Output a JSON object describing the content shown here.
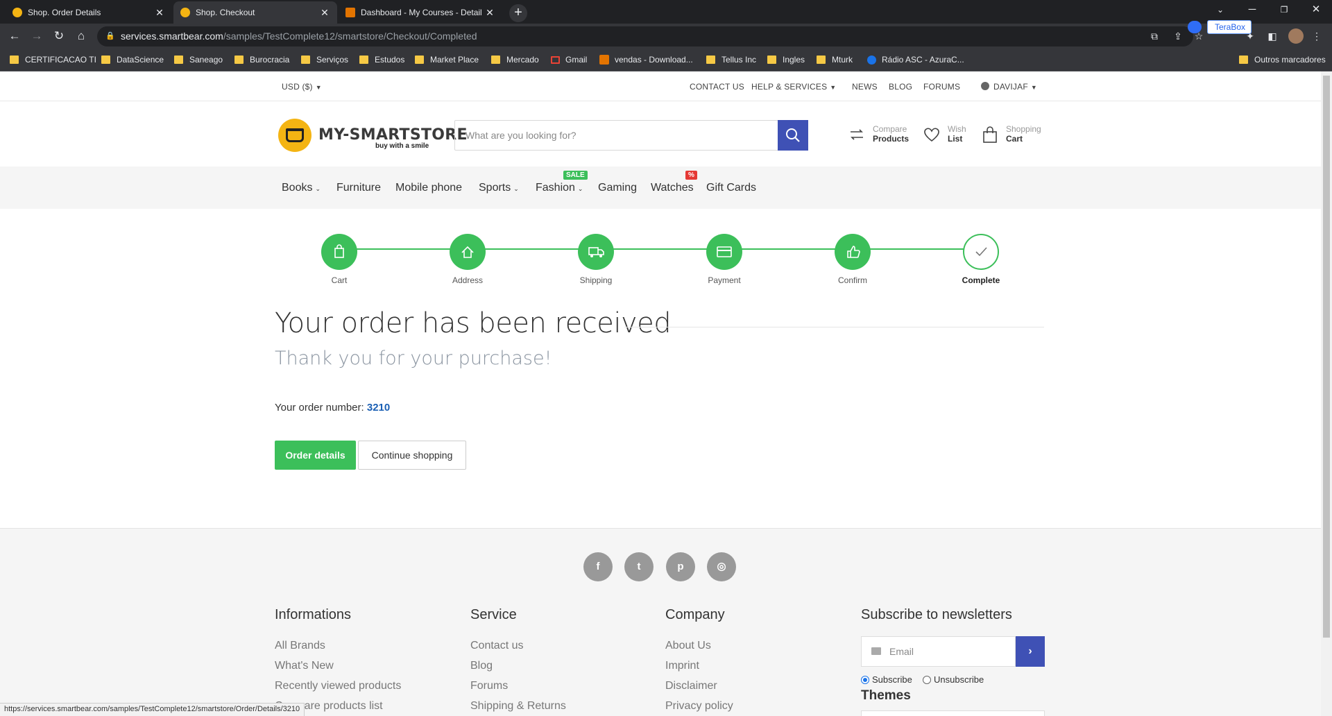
{
  "browser": {
    "tabs": [
      {
        "title": "Shop. Order Details",
        "favicon_color": "#f4b413"
      },
      {
        "title": "Shop. Checkout",
        "favicon_color": "#f4b413"
      },
      {
        "title": "Dashboard - My Courses - Detail",
        "favicon_color": "#e37400"
      }
    ],
    "url_host": "services.smartbear.com",
    "url_path": "/samples/TestComplete12/smartstore/Checkout/Completed",
    "extension_label": "TeraBox",
    "bookmarks": [
      {
        "label": "CERTIFICACAO TI",
        "icon": "folder-icon"
      },
      {
        "label": "DataScience",
        "icon": "folder-icon"
      },
      {
        "label": "Saneago",
        "icon": "folder-icon"
      },
      {
        "label": "Burocracia",
        "icon": "folder-icon"
      },
      {
        "label": "Serviços",
        "icon": "folder-icon"
      },
      {
        "label": "Estudos",
        "icon": "folder-icon"
      },
      {
        "label": "Market Place",
        "icon": "folder-icon"
      },
      {
        "label": "Mercado",
        "icon": "folder-icon"
      },
      {
        "label": "Gmail",
        "icon": "gmail-icon"
      },
      {
        "label": "vendas - Download...",
        "icon": "site-icon"
      },
      {
        "label": "Tellus Inc",
        "icon": "folder-icon"
      },
      {
        "label": "Ingles",
        "icon": "folder-icon"
      },
      {
        "label": "Mturk",
        "icon": "folder-icon"
      },
      {
        "label": "Rádio ASC - AzuraC...",
        "icon": "radio-site-icon"
      }
    ],
    "other_bookmarks": "Outros marcadores",
    "status_url": "https://services.smartbear.com/samples/TestComplete12/smartstore/Order/Details/3210"
  },
  "topnav": {
    "currency": "USD  ($)",
    "contact": "CONTACT US",
    "help": "HELP & SERVICES",
    "news": "NEWS",
    "blog": "BLOG",
    "forums": "FORUMS",
    "user": "DAVIJAF"
  },
  "header": {
    "logo_text": "MY-SMARTSTORE",
    "logo_tagline": "buy with a smile",
    "search_placeholder": "What are you looking for?",
    "compare": {
      "top": "Compare",
      "bottom": "Products"
    },
    "wishlist": {
      "top": "Wish",
      "bottom": "List"
    },
    "cart": {
      "top": "Shopping",
      "bottom": "Cart"
    }
  },
  "categories": [
    {
      "label": "Books",
      "dropdown": true
    },
    {
      "label": "Furniture",
      "dropdown": false
    },
    {
      "label": "Mobile phone",
      "dropdown": false
    },
    {
      "label": "Sports",
      "dropdown": true
    },
    {
      "label": "Fashion",
      "dropdown": true,
      "badge": "SALE",
      "badge_color": "#3cbf5a"
    },
    {
      "label": "Gaming",
      "dropdown": false
    },
    {
      "label": "Watches",
      "dropdown": false,
      "badge": "%",
      "badge_color": "#e53935"
    },
    {
      "label": "Gift Cards",
      "dropdown": false
    }
  ],
  "checkout_steps": [
    {
      "label": "Cart",
      "icon": "bag-icon"
    },
    {
      "label": "Address",
      "icon": "home-icon"
    },
    {
      "label": "Shipping",
      "icon": "truck-icon"
    },
    {
      "label": "Payment",
      "icon": "credit-card-icon"
    },
    {
      "label": "Confirm",
      "icon": "thumbs-up-icon"
    },
    {
      "label": "Complete",
      "icon": "check-icon",
      "current": true
    }
  ],
  "main": {
    "title": "Your order has been received",
    "subtitle": "Thank you for your purchase!",
    "order_number_label": "Your order number:",
    "order_number": "3210",
    "order_details_button": "Order details",
    "continue_button": "Continue shopping"
  },
  "footer": {
    "social": [
      "facebook-icon",
      "twitter-icon",
      "pinterest-icon",
      "instagram-icon"
    ],
    "informations": {
      "heading": "Informations",
      "links": [
        "All Brands",
        "What's New",
        "Recently viewed products",
        "Compare products list"
      ]
    },
    "service": {
      "heading": "Service",
      "links": [
        "Contact us",
        "Blog",
        "Forums",
        "Shipping & Returns"
      ]
    },
    "company": {
      "heading": "Company",
      "links": [
        "About Us",
        "Imprint",
        "Disclaimer",
        "Privacy policy"
      ]
    },
    "newsletter": {
      "heading": "Subscribe to newsletters",
      "email_placeholder": "Email",
      "subscribe": "Subscribe",
      "unsubscribe": "Unsubscribe",
      "selected": "Subscribe"
    },
    "themes_heading": "Themes"
  },
  "colors": {
    "accent_green": "#3cbf5a",
    "accent_blue": "#3f51b5",
    "order_link": "#1a5fb4"
  }
}
